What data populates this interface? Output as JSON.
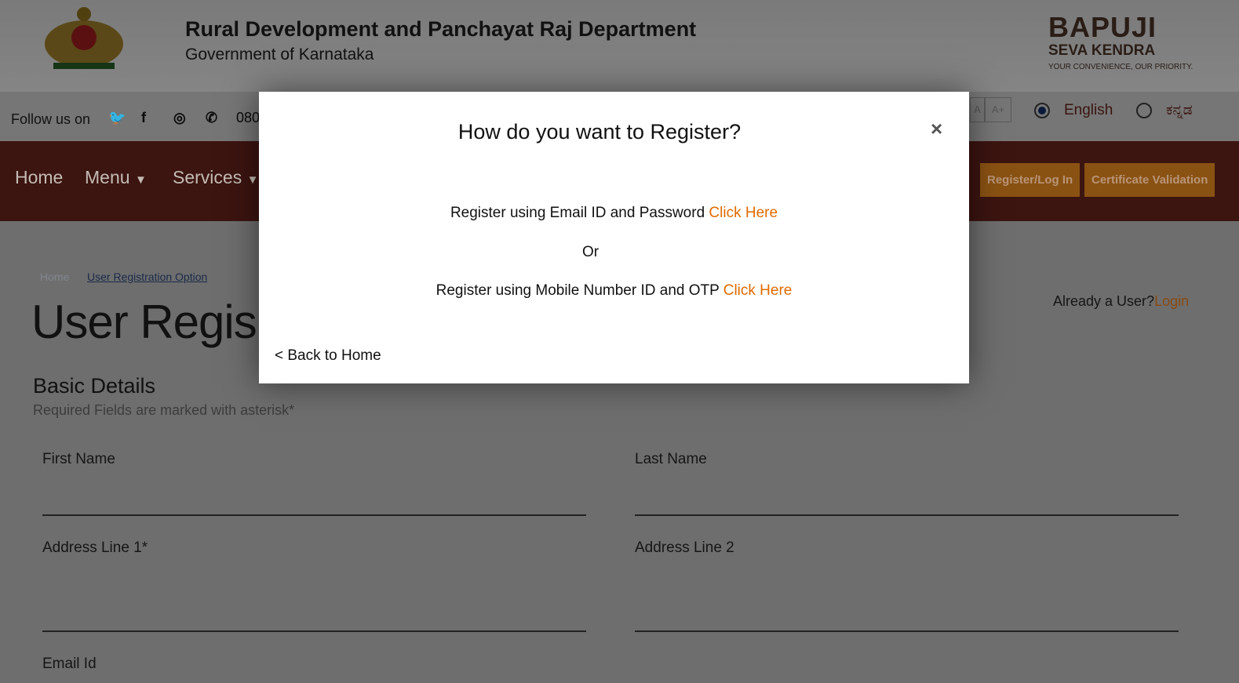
{
  "header": {
    "title": "Rural Development and Panchayat Raj Department",
    "subtitle": "Government of Karnataka",
    "logo_text": [
      "BAPUJI",
      "SEVA KENDRA",
      "YOUR CONVENIENCE, OUR PRIORITY."
    ]
  },
  "topbar": {
    "follow": "Follow us on",
    "phone": "080",
    "font_small": "A",
    "font_large": "A+",
    "lang_en": "English",
    "lang_kn": "ಕನ್ನಡ",
    "selected": "English"
  },
  "nav": {
    "home": "Home",
    "menu": "Menu",
    "services": "Services",
    "register": "Register/Log In",
    "cert": "Certificate Validation"
  },
  "breadcrumb": {
    "home": "Home",
    "current": "User Registration Option"
  },
  "page": {
    "title": "User Regis",
    "already": "Already a User?",
    "login": "Login",
    "section": "Basic Details",
    "required": "Required Fields are marked with asterisk*",
    "fields": {
      "first": "First Name",
      "last": "Last Name",
      "addr1": "Address Line 1*",
      "addr2": "Address Line 2",
      "email": "Email Id"
    }
  },
  "modal": {
    "title": "How do you want to Register?",
    "close": "×",
    "email_text": "Register using Email ID and Password ",
    "email_link": "Click Here",
    "or": "Or",
    "mobile_text": "Register using Mobile Number ID and OTP ",
    "mobile_link": "Click Here",
    "back": "< Back to Home"
  },
  "colors": {
    "nav": "#7a2419",
    "accent": "#f39a1d",
    "link": "#e06a00"
  }
}
